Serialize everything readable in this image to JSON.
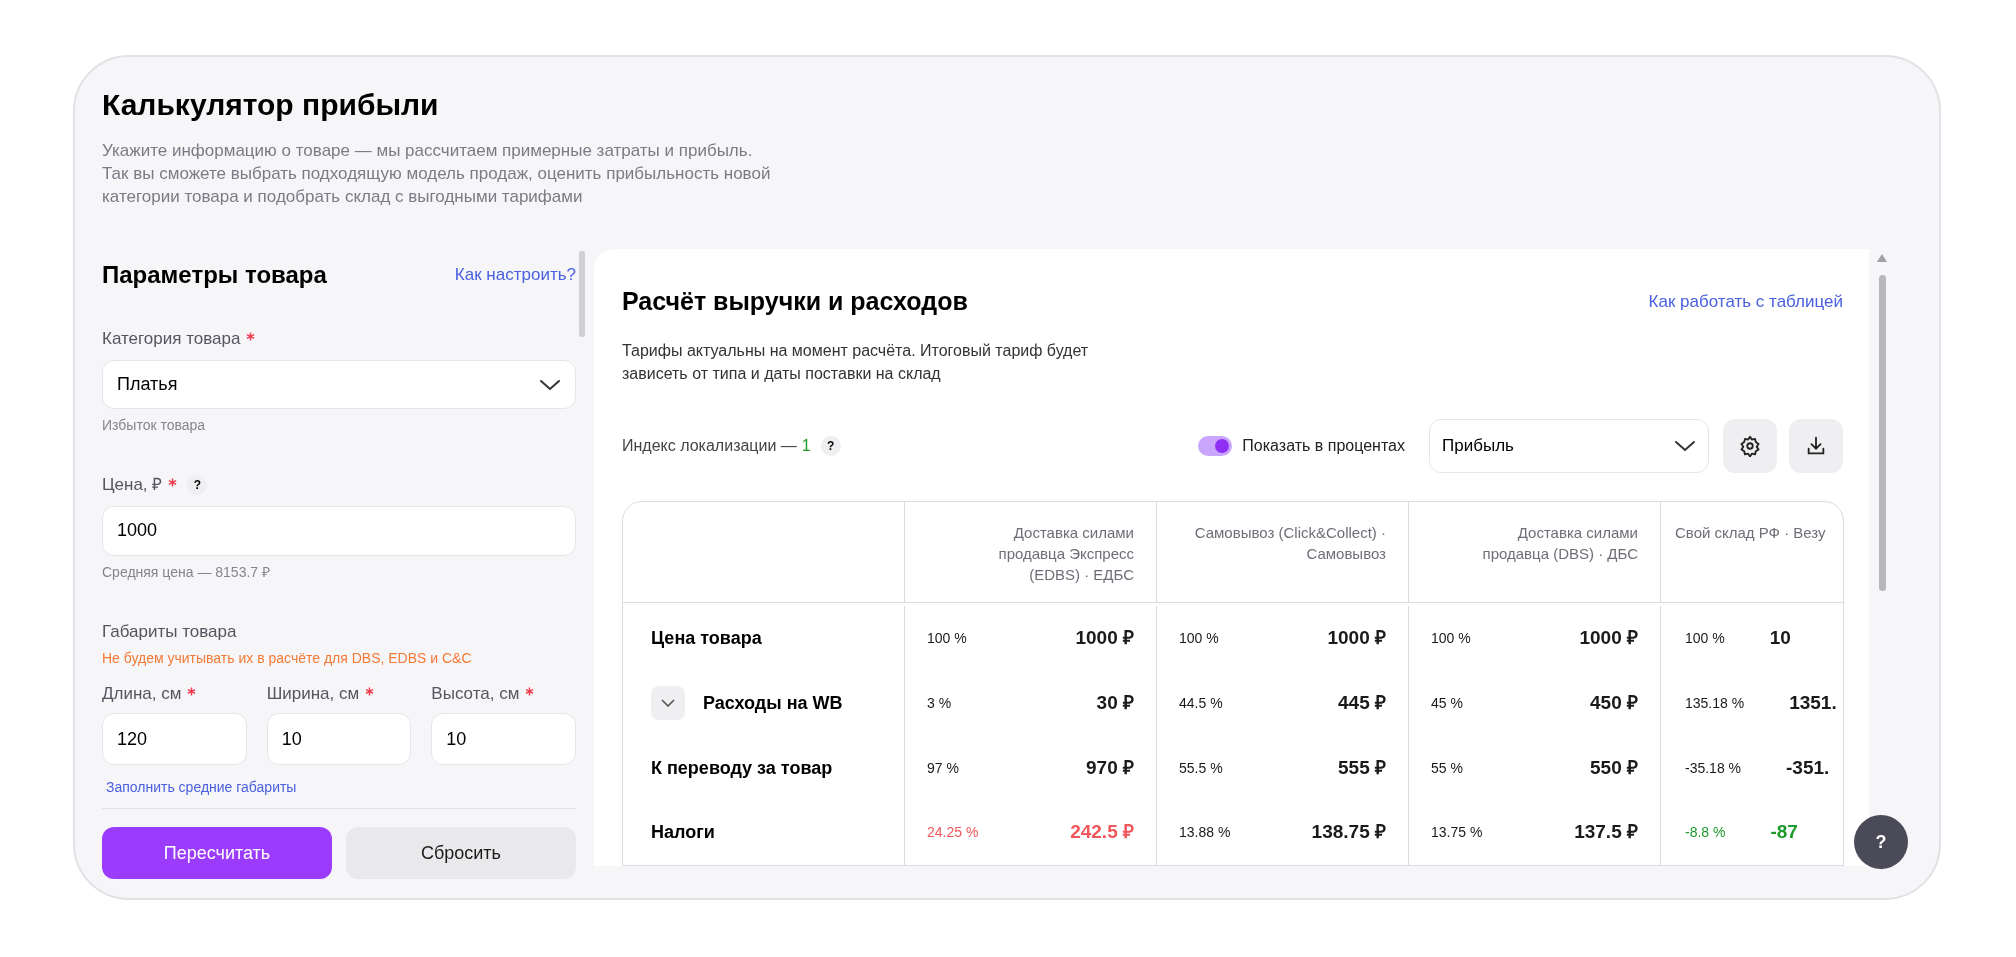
{
  "title": "Калькулятор прибыли",
  "description": [
    "Укажите информацию о товаре — мы рассчитаем примерные затраты и прибыль.",
    "Так вы сможете выбрать подходящую модель продаж, оценить прибыльность новой",
    "категории товара и подобрать склад с выгодными тарифами"
  ],
  "params": {
    "heading": "Параметры товара",
    "help_link": "Как настроить?",
    "category": {
      "label": "Категория товара",
      "required": true,
      "value": "Платья",
      "hint": "Избыток товара"
    },
    "price": {
      "label": "Цена, ₽",
      "required": true,
      "help": "?",
      "value": "1000",
      "hint": "Средняя цена — 8153.7 ₽"
    },
    "dimensions": {
      "title": "Габариты товара",
      "warning": "Не будем учитывать их в расчёте для DBS, EDBS и C&C",
      "fields": [
        {
          "label": "Длина, см",
          "required": true,
          "value": "120"
        },
        {
          "label": "Ширина, см",
          "required": true,
          "value": "10"
        },
        {
          "label": "Высота, см",
          "required": true,
          "value": "10"
        }
      ],
      "fill_link": "Заполнить средние габариты"
    },
    "buttons": [
      {
        "label": "Пересчитать",
        "kind": "primary"
      },
      {
        "label": "Сбросить",
        "kind": "secondary"
      }
    ]
  },
  "calc": {
    "heading": "Расчёт выручки и расходов",
    "help_link": "Как работать с таблицей",
    "note": [
      "Тарифы актуальны на момент расчёта. Итоговый тариф будет",
      "зависеть от типа и даты поставки на склад"
    ],
    "index_label": "Индекс локализации —",
    "index_value": "1",
    "index_help": "?",
    "toggle": {
      "label": "Показать в процентах",
      "on": true
    },
    "metric_select": "Прибыль",
    "table": {
      "columns": [
        "Доставка силами продавца Экспресс (EDBS) · ЕДБС",
        "Самовывоз (Click&Collect) · Самовывоз",
        "Доставка силами продавца (DBS) · ДБС",
        "Свой склад РФ · Везу"
      ],
      "rows": [
        {
          "label": "Цена товара",
          "expandable": false,
          "cells": [
            {
              "percent": "100 %",
              "amount": "1000 ₽",
              "color": "#1a1a1a"
            },
            {
              "percent": "100 %",
              "amount": "1000 ₽",
              "color": "#1a1a1a"
            },
            {
              "percent": "100 %",
              "amount": "1000 ₽",
              "color": "#1a1a1a"
            },
            {
              "percent": "100 %",
              "amount": "10",
              "color": "#1a1a1a"
            }
          ]
        },
        {
          "label": "Расходы на WB",
          "expandable": true,
          "expanded": false,
          "cells": [
            {
              "percent": "3 %",
              "amount": "30 ₽",
              "color": "#1a1a1a"
            },
            {
              "percent": "44.5 %",
              "amount": "445 ₽",
              "color": "#1a1a1a"
            },
            {
              "percent": "45 %",
              "amount": "450 ₽",
              "color": "#1a1a1a"
            },
            {
              "percent": "135.18 %",
              "amount": "1351.",
              "color": "#1a1a1a"
            }
          ]
        },
        {
          "label": "К переводу за товар",
          "expandable": false,
          "cells": [
            {
              "percent": "97 %",
              "amount": "970 ₽",
              "color": "#1a1a1a"
            },
            {
              "percent": "55.5 %",
              "amount": "555 ₽",
              "color": "#1a1a1a"
            },
            {
              "percent": "55 %",
              "amount": "550 ₽",
              "color": "#1a1a1a"
            },
            {
              "percent": "-35.18 %",
              "amount": "-351.",
              "color": "#1a1a1a"
            }
          ]
        },
        {
          "label": "Налоги",
          "expandable": false,
          "cells": [
            {
              "percent": "24.25 %",
              "amount": "242.5 ₽",
              "color": "#f0575a"
            },
            {
              "percent": "13.88 %",
              "amount": "138.75 ₽",
              "color": "#1a1a1a"
            },
            {
              "percent": "13.75 %",
              "amount": "137.5 ₽",
              "color": "#1a1a1a"
            },
            {
              "percent": "-8.8 %",
              "amount": "-87",
              "color": "#1d9a2a"
            }
          ]
        }
      ]
    }
  },
  "help_button": "?"
}
